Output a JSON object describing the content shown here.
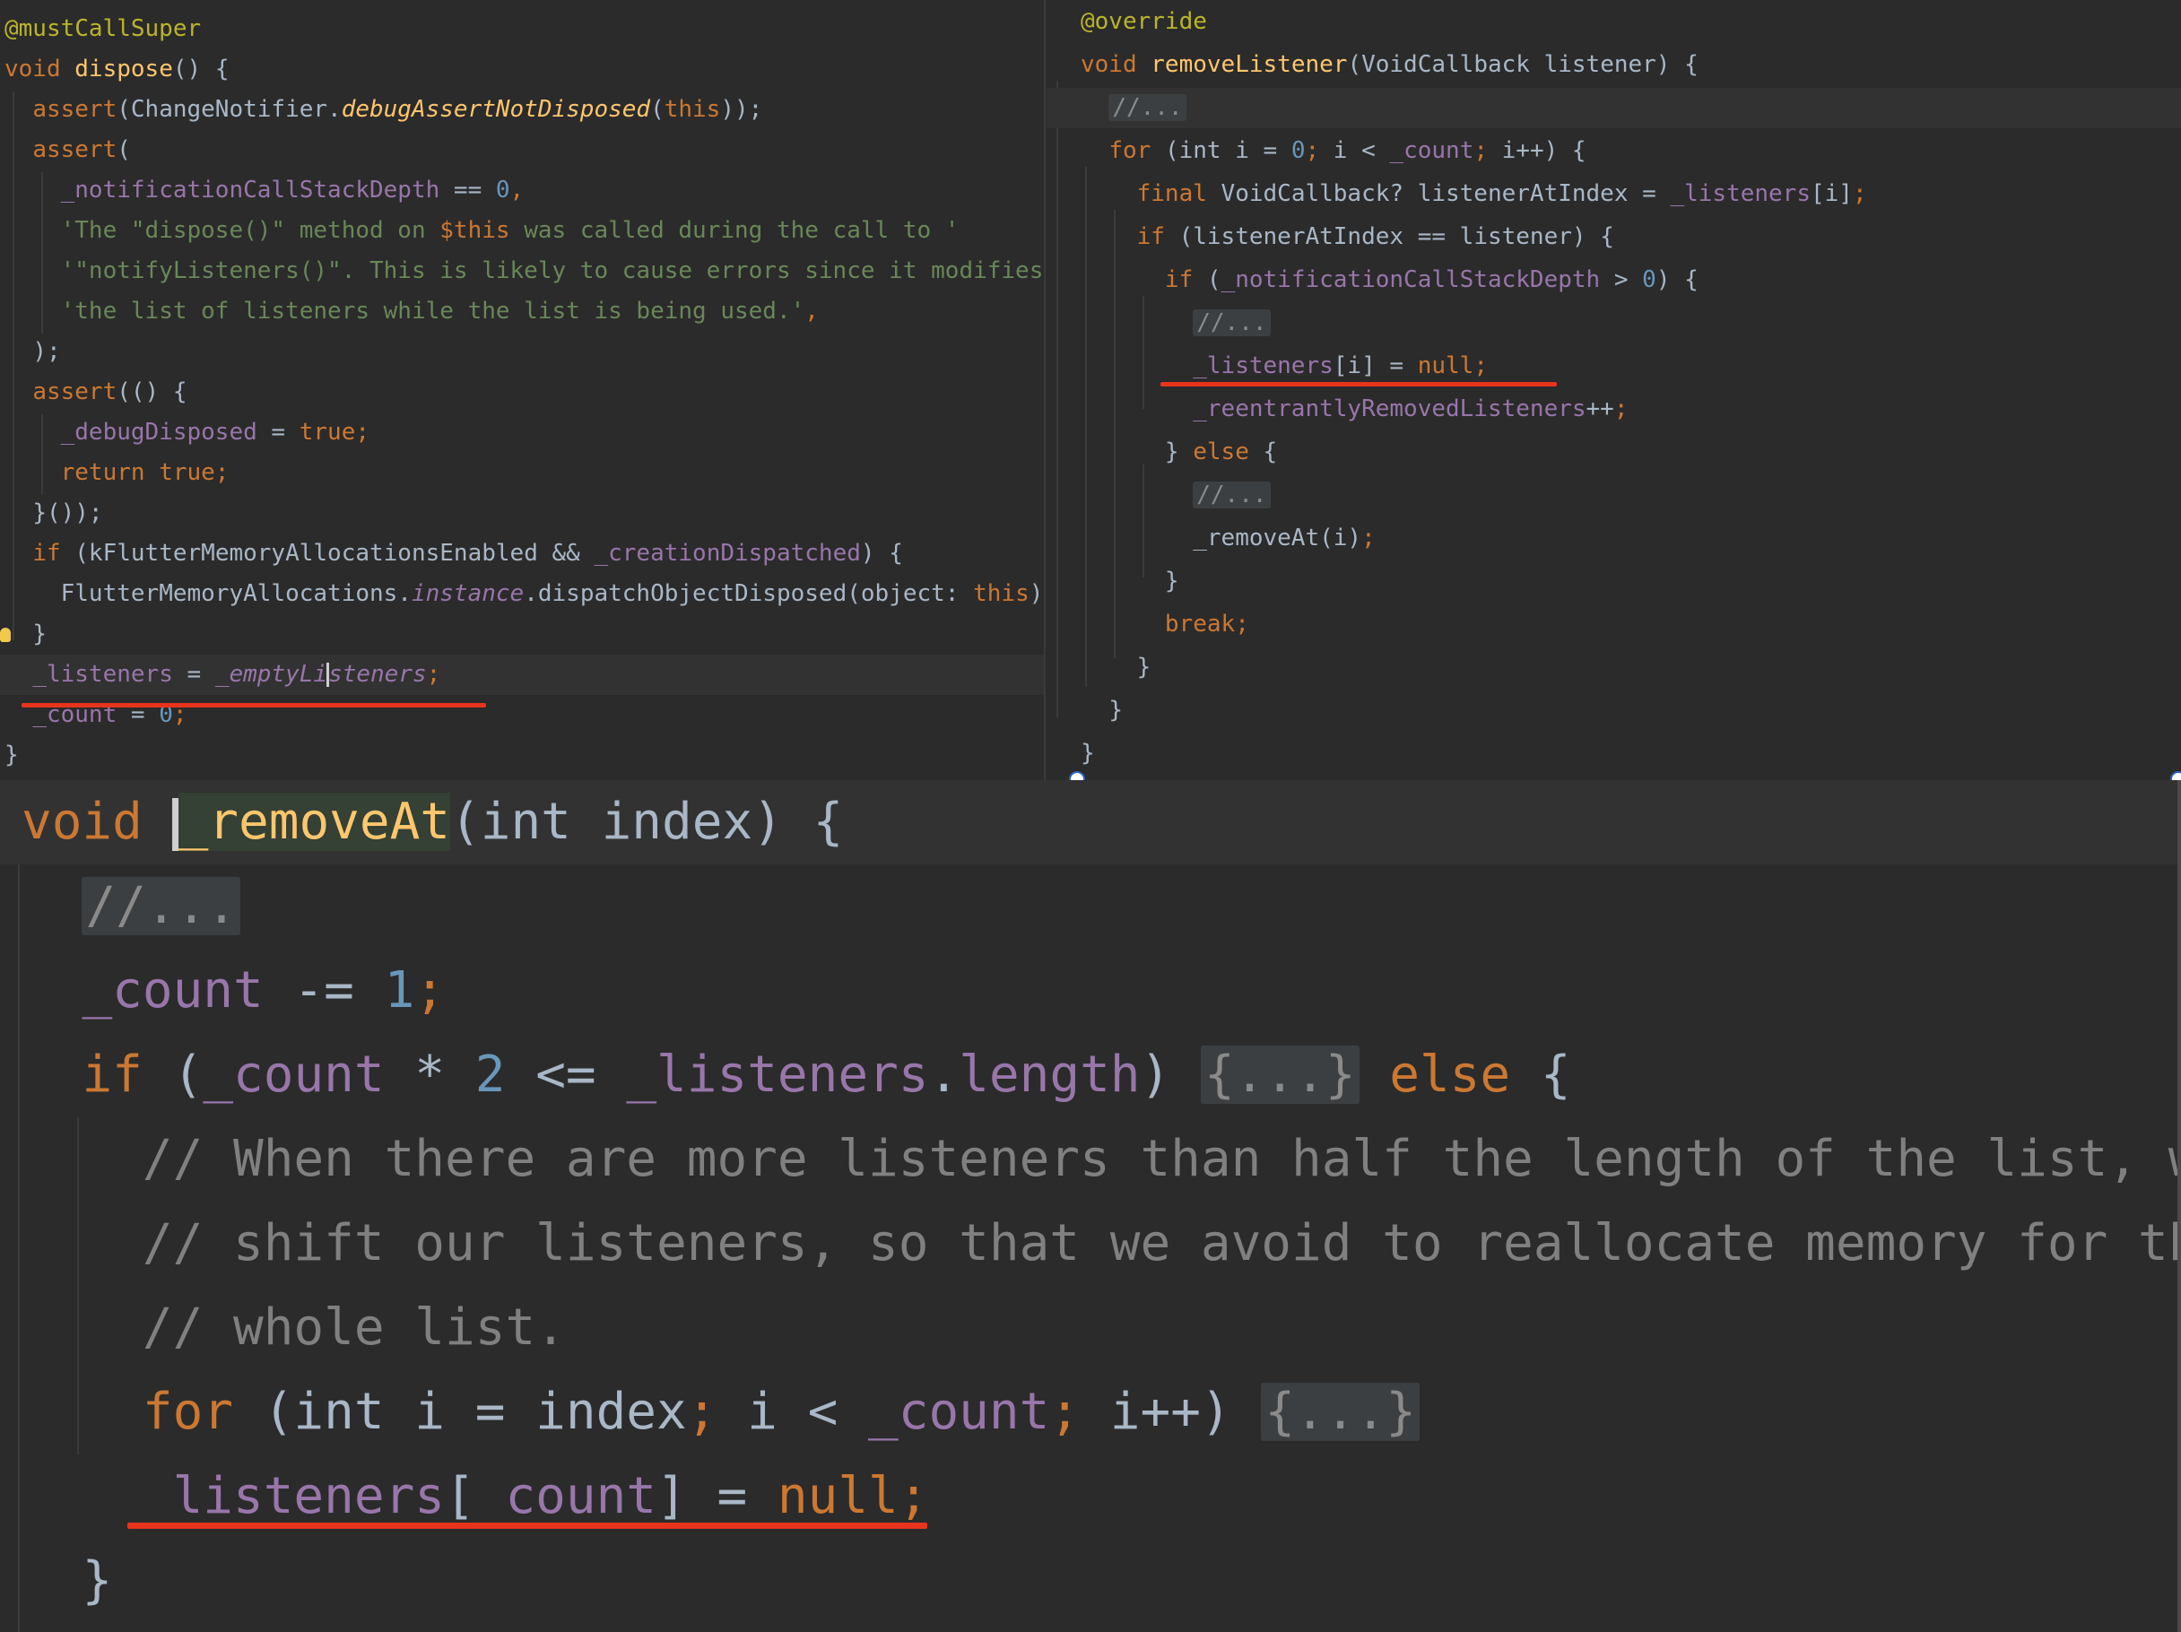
{
  "panels": {
    "dispose": {
      "lines": [
        [
          [
            "t-ann",
            "@mustCallSuper"
          ]
        ],
        [
          [
            "t-kw",
            "void "
          ],
          [
            "t-fn",
            "dispose"
          ],
          [
            "",
            "() {"
          ]
        ],
        [
          [
            "",
            "  "
          ],
          [
            "t-kw",
            "assert"
          ],
          [
            "",
            "(ChangeNotifier."
          ],
          [
            "t-fn t-it",
            "debugAssertNotDisposed"
          ],
          [
            "",
            "("
          ],
          [
            "t-kw",
            "this"
          ],
          [
            "",
            "));"
          ]
        ],
        [
          [
            "",
            "  "
          ],
          [
            "t-kw",
            "assert"
          ],
          [
            "",
            "("
          ]
        ],
        [
          [
            "",
            "    "
          ],
          [
            "t-fld",
            "_notificationCallStackDepth"
          ],
          [
            "",
            " == "
          ],
          [
            "t-num",
            "0"
          ],
          [
            "t-kw",
            ","
          ]
        ],
        [
          [
            "",
            "    "
          ],
          [
            "t-str",
            "'The \"dispose()\" method on "
          ],
          [
            "t-kw",
            "$this"
          ],
          [
            "t-str",
            " was called during the call to '"
          ]
        ],
        [
          [
            "",
            "    "
          ],
          [
            "t-str",
            "'\"notifyListeners()\". This is likely to cause errors since it modifies '"
          ]
        ],
        [
          [
            "",
            "    "
          ],
          [
            "t-str",
            "'the list of listeners while the list is being used.'"
          ],
          [
            "t-kw",
            ","
          ]
        ],
        [
          [
            "",
            "  "
          ],
          [
            "",
            ");"
          ]
        ],
        [
          [
            "",
            "  "
          ],
          [
            "t-kw",
            "assert"
          ],
          [
            "",
            "(() {"
          ]
        ],
        [
          [
            "",
            "    "
          ],
          [
            "t-fld",
            "_debugDisposed"
          ],
          [
            "",
            " = "
          ],
          [
            "t-kw",
            "true;"
          ]
        ],
        [
          [
            "",
            "    "
          ],
          [
            "t-kw",
            "return true;"
          ]
        ],
        [
          [
            "",
            "  "
          ],
          [
            "",
            "}());"
          ]
        ],
        [
          [
            "",
            "  "
          ],
          [
            "t-kw",
            "if "
          ],
          [
            "",
            "(kFlutterMemoryAllocationsEnabled && "
          ],
          [
            "t-fld",
            "_creationDispatched"
          ],
          [
            "",
            ") {"
          ]
        ],
        [
          [
            "",
            "    "
          ],
          [
            "",
            "FlutterMemoryAllocations."
          ],
          [
            "t-stat",
            "instance"
          ],
          [
            "",
            ".dispatchObjectDisposed(object: "
          ],
          [
            "t-kw",
            "this"
          ],
          [
            "",
            ");"
          ]
        ],
        [
          [
            "",
            "  "
          ],
          [
            "",
            "}"
          ]
        ],
        [
          [
            "",
            "  "
          ],
          [
            "t-fld",
            "_listeners"
          ],
          [
            "",
            " = "
          ],
          [
            "t-stat",
            "_emptyLi"
          ],
          [
            "caret",
            ""
          ],
          [
            "t-stat",
            "steners"
          ],
          [
            "t-kw",
            ";"
          ]
        ],
        [
          [
            "",
            "  "
          ],
          [
            "t-fld",
            "_count"
          ],
          [
            "",
            " = "
          ],
          [
            "t-num",
            "0"
          ],
          [
            "t-kw",
            ";"
          ]
        ],
        [
          [
            "",
            "}"
          ]
        ]
      ]
    },
    "remove_listener": {
      "lines": [
        [
          [
            "t-ann",
            "@override"
          ]
        ],
        [
          [
            "t-kw",
            "void "
          ],
          [
            "t-fn",
            "removeListener"
          ],
          [
            "",
            "(VoidCallback listener) {"
          ]
        ],
        [
          [
            "",
            "  "
          ],
          [
            "t-com fold",
            "//..."
          ]
        ],
        [
          [
            "",
            "  "
          ],
          [
            "t-kw",
            "for "
          ],
          [
            "",
            "(int i = "
          ],
          [
            "t-num",
            "0"
          ],
          [
            "t-kw",
            "; "
          ],
          [
            "",
            "i < "
          ],
          [
            "t-fld",
            "_count"
          ],
          [
            "t-kw",
            "; "
          ],
          [
            "",
            "i++) {"
          ]
        ],
        [
          [
            "",
            "    "
          ],
          [
            "t-kw",
            "final "
          ],
          [
            "",
            "VoidCallback? listenerAtIndex = "
          ],
          [
            "t-fld",
            "_listeners"
          ],
          [
            "",
            "[i]"
          ],
          [
            "t-kw",
            ";"
          ]
        ],
        [
          [
            "",
            "    "
          ],
          [
            "t-kw",
            "if "
          ],
          [
            "",
            "(listenerAtIndex == listener) {"
          ]
        ],
        [
          [
            "",
            "      "
          ],
          [
            "t-kw",
            "if "
          ],
          [
            "",
            "("
          ],
          [
            "t-fld",
            "_notificationCallStackDepth"
          ],
          [
            "",
            " > "
          ],
          [
            "t-num",
            "0"
          ],
          [
            "",
            ") {"
          ]
        ],
        [
          [
            "",
            "        "
          ],
          [
            "t-com fold",
            "//..."
          ]
        ],
        [
          [
            "",
            "        "
          ],
          [
            "t-fld",
            "_listeners"
          ],
          [
            "",
            "[i] = "
          ],
          [
            "t-kw",
            "null;"
          ]
        ],
        [
          [
            "",
            "        "
          ],
          [
            "t-fld",
            "_reentrantlyRemovedListeners"
          ],
          [
            "",
            "++"
          ],
          [
            "t-kw",
            ";"
          ]
        ],
        [
          [
            "",
            "      "
          ],
          [
            "",
            "} "
          ],
          [
            "t-kw",
            "else "
          ],
          [
            "",
            "{"
          ]
        ],
        [
          [
            "",
            "        "
          ],
          [
            "t-com fold",
            "//..."
          ]
        ],
        [
          [
            "",
            "        "
          ],
          [
            "",
            "_removeAt(i)"
          ],
          [
            "t-kw",
            ";"
          ]
        ],
        [
          [
            "",
            "      "
          ],
          [
            "",
            "}"
          ]
        ],
        [
          [
            "",
            "      "
          ],
          [
            "t-kw",
            "break;"
          ]
        ],
        [
          [
            "",
            "    "
          ],
          [
            "",
            "}"
          ]
        ],
        [
          [
            "",
            "  "
          ],
          [
            "",
            "}"
          ]
        ],
        [
          [
            "",
            "}"
          ]
        ]
      ]
    },
    "remove_at": {
      "lines": [
        [
          [
            "t-kw",
            "void "
          ],
          [
            "caret",
            ""
          ],
          [
            "t-fn fn-decl-hl",
            "_removeAt"
          ],
          [
            "",
            "(int index) {"
          ]
        ],
        [
          [
            "",
            "  "
          ],
          [
            "t-com fold",
            "//..."
          ]
        ],
        [
          [
            "",
            "  "
          ],
          [
            "t-fld",
            "_count"
          ],
          [
            "",
            " -= "
          ],
          [
            "t-num",
            "1"
          ],
          [
            "t-kw",
            ";"
          ]
        ],
        [
          [
            "",
            "  "
          ],
          [
            "t-kw",
            "if "
          ],
          [
            "",
            "("
          ],
          [
            "t-fld",
            "_count"
          ],
          [
            "",
            " * "
          ],
          [
            "t-num",
            "2"
          ],
          [
            "",
            " <= "
          ],
          [
            "t-fld",
            "_listeners"
          ],
          [
            "",
            "."
          ],
          [
            "t-fld",
            "length"
          ],
          [
            "",
            ") "
          ],
          [
            "fold",
            "{...}"
          ],
          [
            "t-kw",
            " else "
          ],
          [
            "",
            "{"
          ]
        ],
        [
          [
            "",
            "    "
          ],
          [
            "t-com",
            "// When there are more listeners than half the length of the list, we only"
          ]
        ],
        [
          [
            "",
            "    "
          ],
          [
            "t-com",
            "// shift our listeners, so that we avoid to reallocate memory for the"
          ]
        ],
        [
          [
            "",
            "    "
          ],
          [
            "t-com",
            "// whole list."
          ]
        ],
        [
          [
            "",
            "    "
          ],
          [
            "t-kw",
            "for "
          ],
          [
            "",
            "(int i = index"
          ],
          [
            "t-kw",
            "; "
          ],
          [
            "",
            "i < "
          ],
          [
            "t-fld",
            "_count"
          ],
          [
            "t-kw",
            "; "
          ],
          [
            "",
            "i++) "
          ],
          [
            "fold",
            "{...}"
          ]
        ],
        [
          [
            "",
            "    "
          ],
          [
            "t-fld",
            "_listeners"
          ],
          [
            "",
            "["
          ],
          [
            "t-fld",
            "_count"
          ],
          [
            "",
            "] = "
          ],
          [
            "t-kw",
            "null;"
          ]
        ],
        [
          [
            "",
            "  "
          ],
          [
            "",
            "}"
          ]
        ]
      ]
    }
  }
}
